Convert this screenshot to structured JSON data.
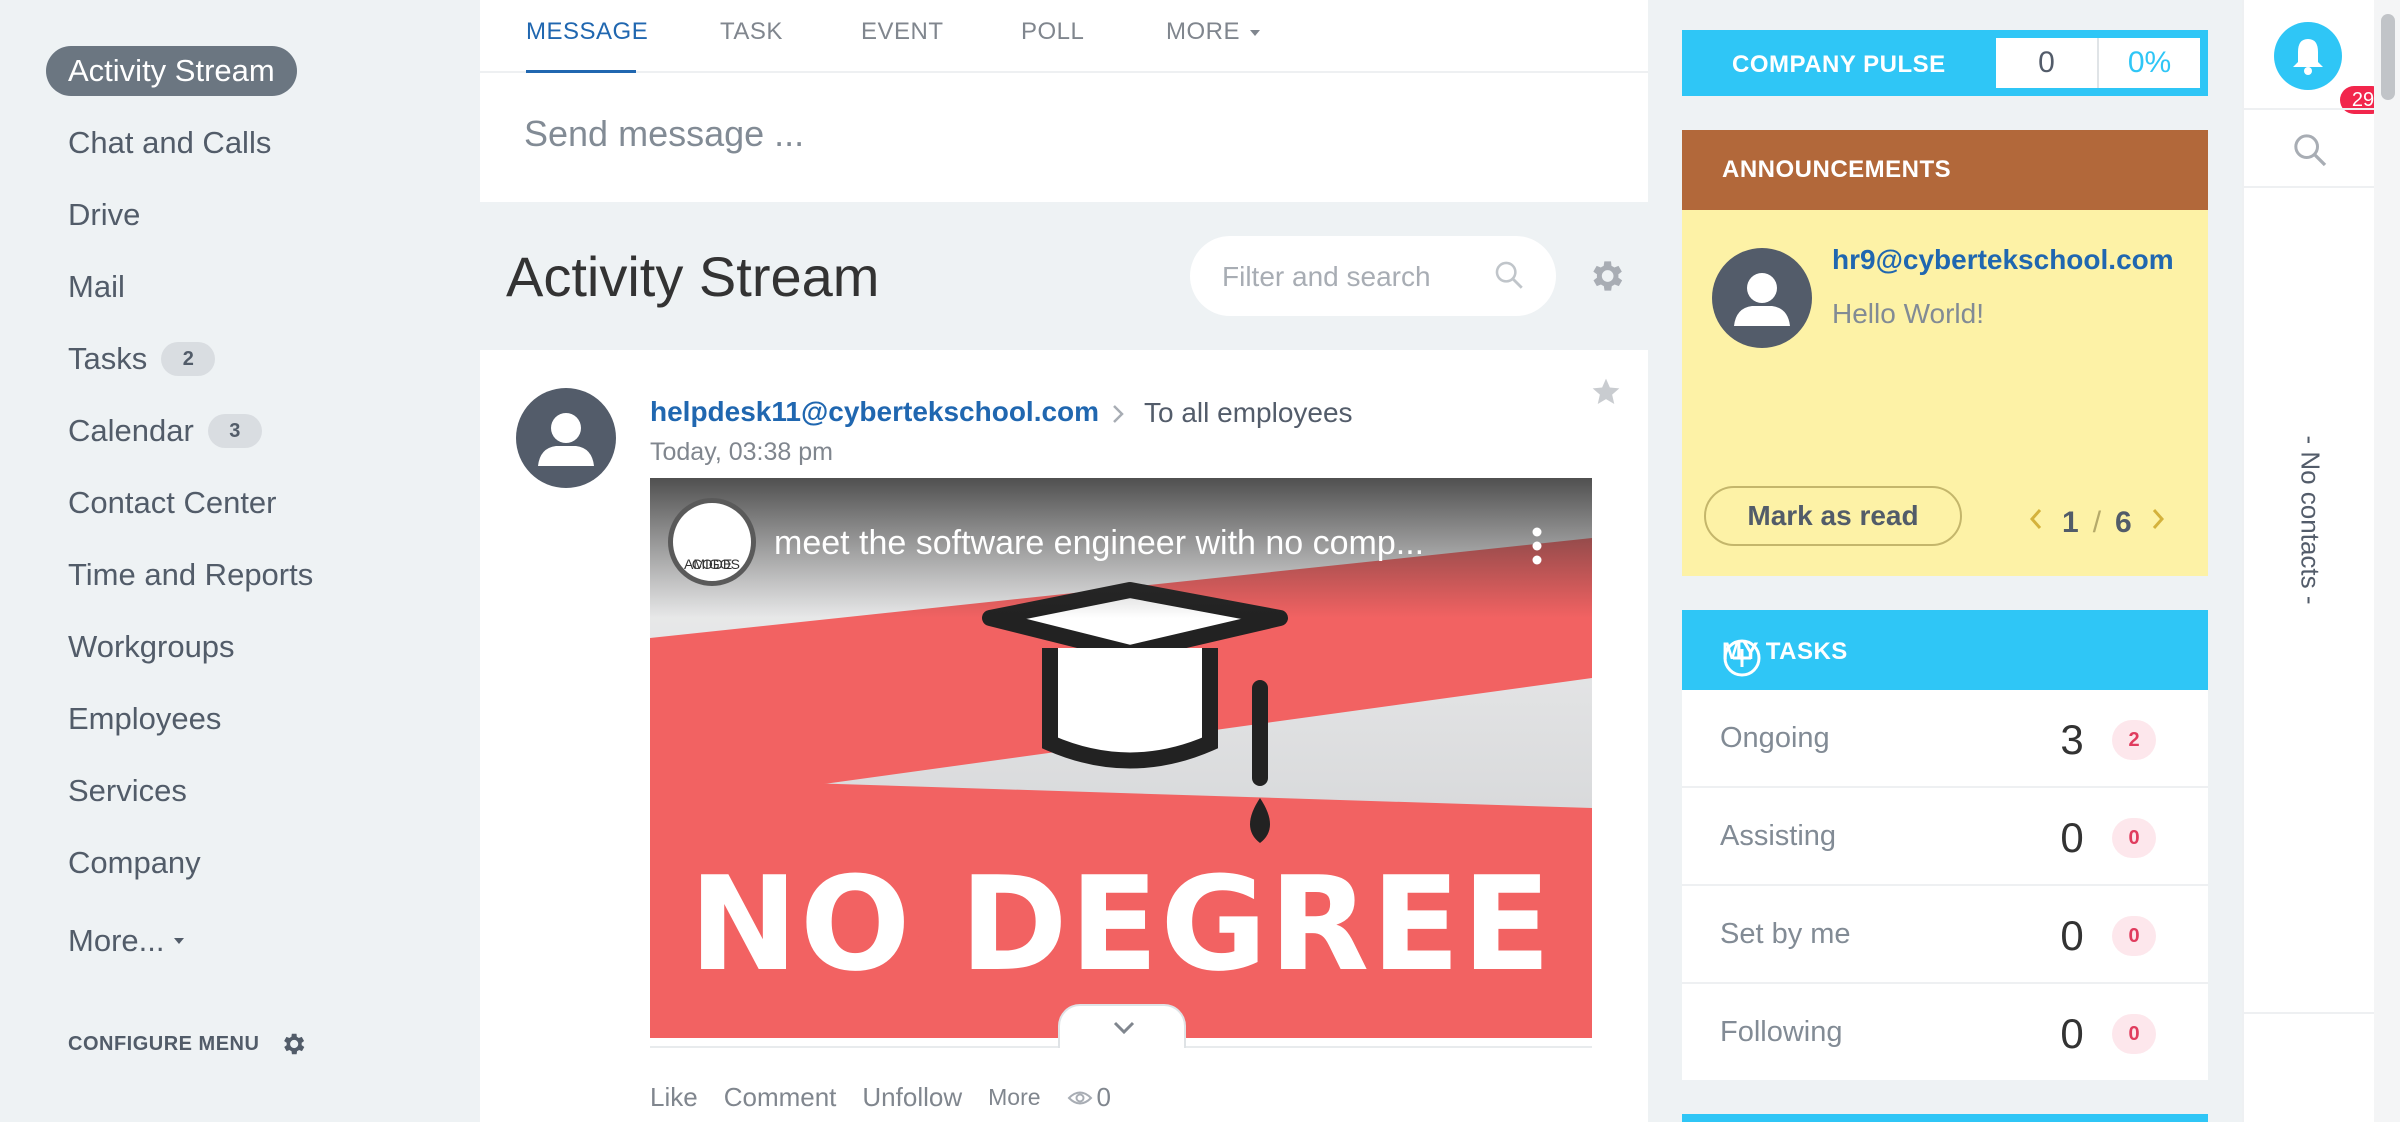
{
  "sidebar": {
    "items": [
      {
        "label": "Activity Stream"
      },
      {
        "label": "Chat and Calls"
      },
      {
        "label": "Drive"
      },
      {
        "label": "Mail"
      },
      {
        "label": "Tasks",
        "badge": "2"
      },
      {
        "label": "Calendar",
        "badge": "3"
      },
      {
        "label": "Contact Center"
      },
      {
        "label": "Time and Reports"
      },
      {
        "label": "Workgroups"
      },
      {
        "label": "Employees"
      },
      {
        "label": "Services"
      },
      {
        "label": "Company"
      },
      {
        "label": "More..."
      }
    ],
    "configure_label": "CONFIGURE MENU"
  },
  "composer": {
    "tabs": [
      "MESSAGE",
      "TASK",
      "EVENT",
      "POLL",
      "MORE"
    ],
    "placeholder": "Send message ..."
  },
  "stream": {
    "title": "Activity Stream",
    "filter_placeholder": "Filter and search"
  },
  "post": {
    "author": "helpdesk11@cybertekschool.com",
    "recipient": "To all employees",
    "time": "Today, 03:38 pm",
    "video": {
      "title": "meet the software engineer with no comp...",
      "channel_logo_line1": "AMIGOS",
      "channel_logo_line2": "CODE",
      "thumbnail_text": "NO DEGREE"
    },
    "actions": [
      "Like",
      "Comment",
      "Unfollow",
      "More"
    ],
    "views": "0"
  },
  "pulse": {
    "label": "COMPANY PULSE",
    "value": "0",
    "percent": "0%"
  },
  "announcements": {
    "header": "ANNOUNCEMENTS",
    "author": "hr9@cybertekschool.com",
    "text": "Hello World!",
    "mark_read_label": "Mark as read",
    "page_current": "1",
    "page_sep": "/",
    "page_total": "6"
  },
  "my_tasks": {
    "header": "MY TASKS",
    "rows": [
      {
        "label": "Ongoing",
        "count": "3",
        "badge": "2"
      },
      {
        "label": "Assisting",
        "count": "0",
        "badge": "0"
      },
      {
        "label": "Set by me",
        "count": "0",
        "badge": "0"
      },
      {
        "label": "Following",
        "count": "0",
        "badge": "0"
      }
    ]
  },
  "right_strip": {
    "notifications": "29",
    "no_contacts": "- No contacts -"
  },
  "colors": {
    "accent_blue": "#2fc6f6",
    "link_blue": "#2067b0",
    "announcement_header": "#b2683a",
    "announcement_bg": "#fdf2a6",
    "badge_red": "#f2264c"
  }
}
